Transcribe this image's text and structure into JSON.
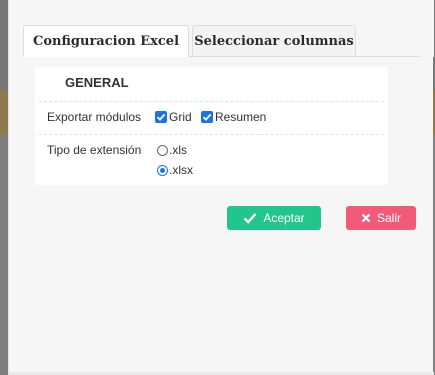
{
  "tabs": [
    {
      "label": "Configuracion Excel",
      "active": true
    },
    {
      "label": "Seleccionar columnas",
      "active": false
    }
  ],
  "general": {
    "title": "GENERAL",
    "export_modules": {
      "label": "Exportar módulos",
      "options": [
        {
          "label": "Grid",
          "checked": true
        },
        {
          "label": "Resumen",
          "checked": true
        }
      ]
    },
    "extension": {
      "label": "Tipo de extensión",
      "options": [
        {
          "label": ".xls",
          "selected": false
        },
        {
          "label": ".xlsx",
          "selected": true
        }
      ]
    }
  },
  "buttons": {
    "accept": {
      "label": "Aceptar",
      "icon": "check-icon",
      "color": "#22c58b"
    },
    "exit": {
      "label": "Salir",
      "icon": "x-icon",
      "color": "#f15a78"
    }
  },
  "colors": {
    "accent": "#1a73e8"
  }
}
